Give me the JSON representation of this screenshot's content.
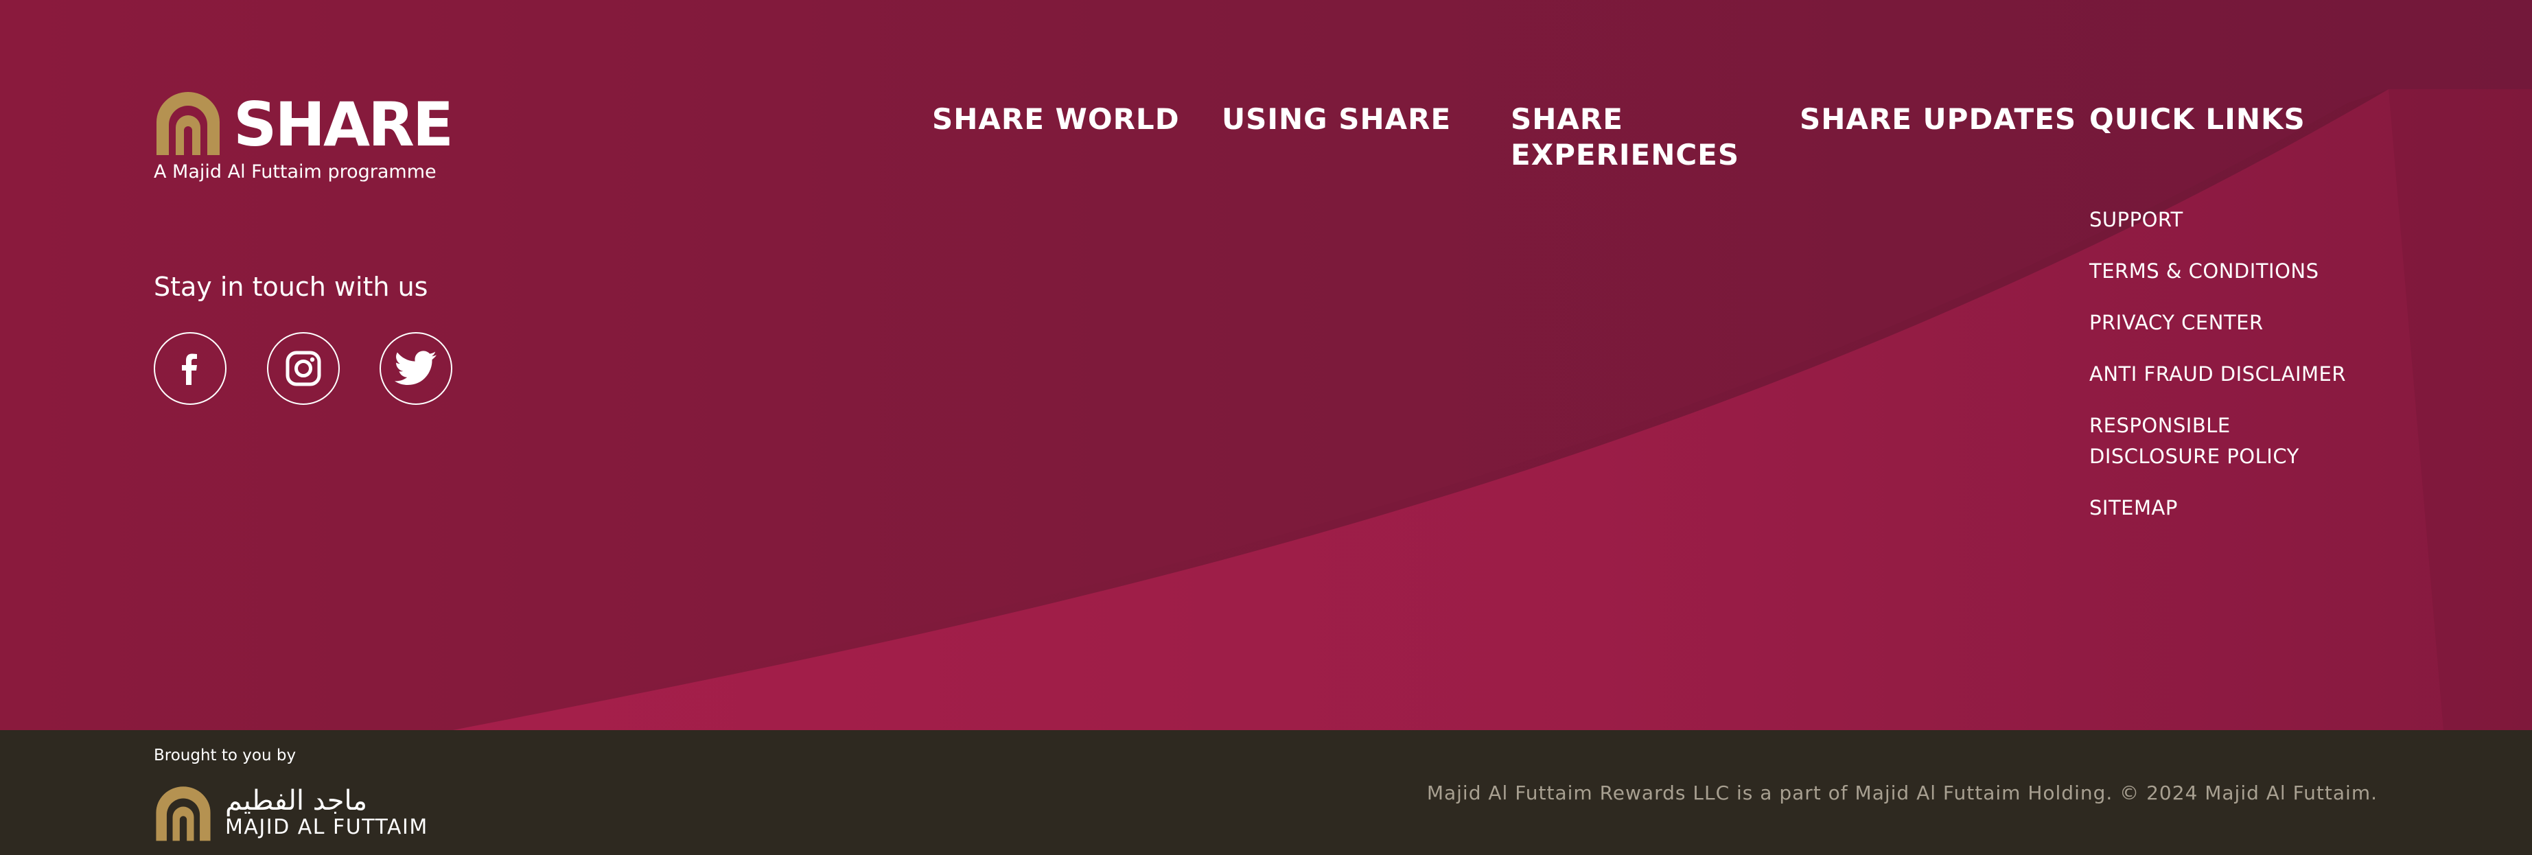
{
  "colors": {
    "background_top": "#7e1a3b",
    "swoosh": "#a51f4a",
    "background_bottom": "#2e2920",
    "gold": "#b59251",
    "text": "#ffffff",
    "copyright_text": "#a8a091"
  },
  "brand": {
    "name": "SHARE",
    "tagline": "A Majid Al Futtaim programme",
    "icon": "share-arch-logo-icon"
  },
  "social": {
    "heading": "Stay in touch with us",
    "links": [
      {
        "name": "facebook",
        "icon": "facebook-icon"
      },
      {
        "name": "instagram",
        "icon": "instagram-icon"
      },
      {
        "name": "twitter",
        "icon": "twitter-icon"
      }
    ]
  },
  "nav": {
    "share_world": "SHARE WORLD",
    "using_share": "USING SHARE",
    "share_experiences_1": "SHARE",
    "share_experiences_2": "EXPERIENCES",
    "share_updates": "SHARE UPDATES",
    "quick_links": "QUICK LINKS"
  },
  "quick_links": {
    "support": "SUPPORT",
    "terms": "TERMS & CONDITIONS",
    "privacy": "PRIVACY CENTER",
    "anti_fraud": "ANTI FRAUD DISCLAIMER",
    "responsible_1": "RESPONSIBLE",
    "responsible_2": "DISCLOSURE POLICY",
    "sitemap": "SITEMAP"
  },
  "bottom": {
    "brought_by": "Brought to you by",
    "maf_arabic": "ماجد الفطيم",
    "maf_latin": "MAJID AL FUTTAIM",
    "copyright": "Majid Al Futtaim Rewards LLC is a part of Majid Al Futtaim Holding. © 2024 Majid Al Futtaim."
  }
}
